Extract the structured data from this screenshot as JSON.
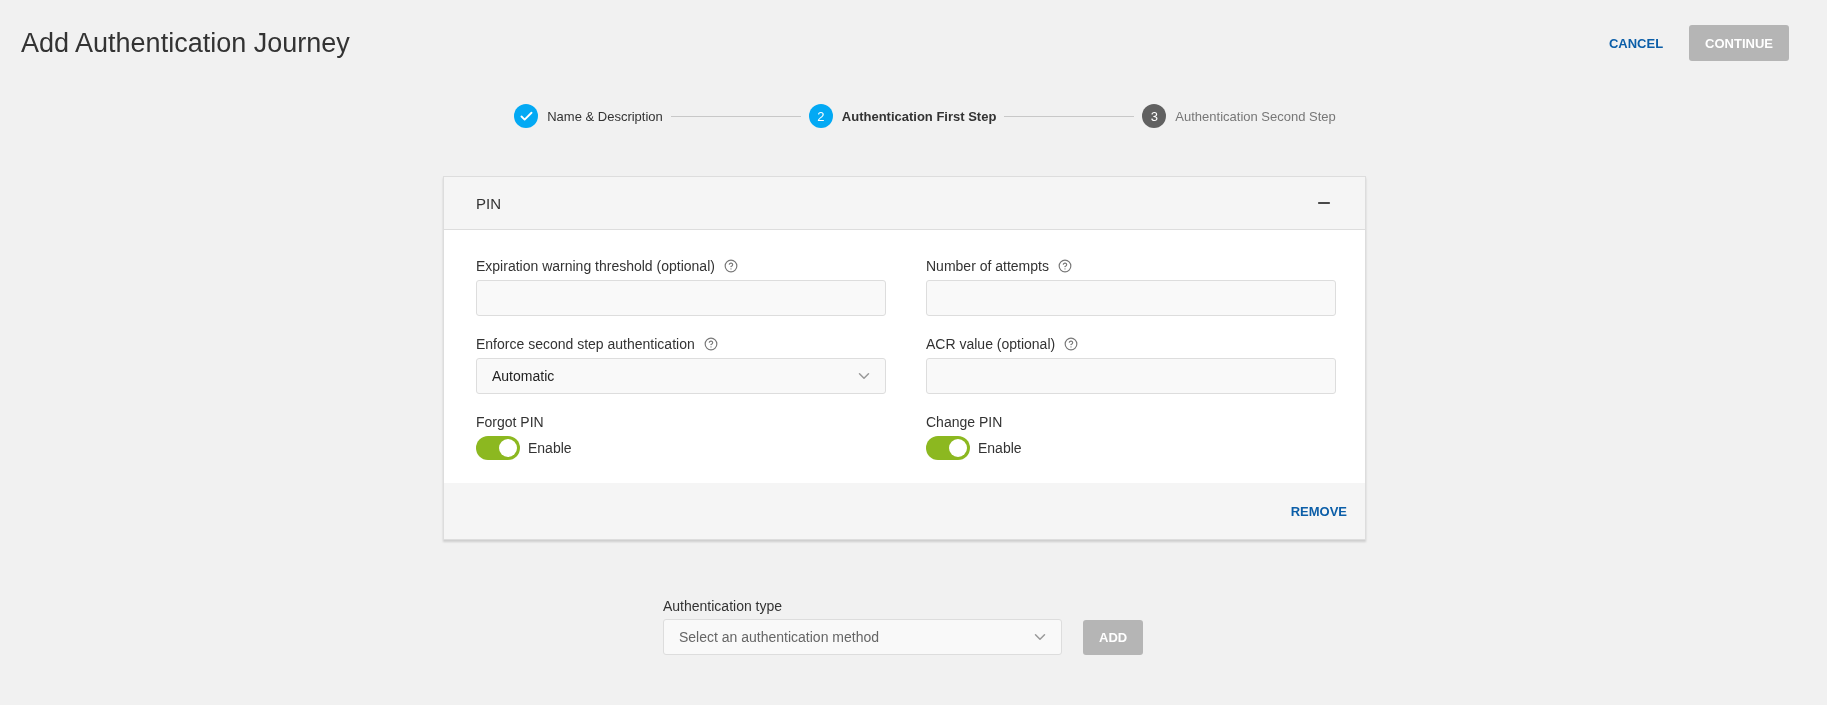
{
  "page": {
    "title": "Add Authentication Journey"
  },
  "actions": {
    "cancel": "CANCEL",
    "continue": {
      "label": "CONTINUE",
      "disabled": true
    }
  },
  "steps": [
    {
      "kind": "done",
      "label": "Name & Description"
    },
    {
      "kind": "active",
      "number": "2",
      "label": "Authentication First Step"
    },
    {
      "kind": "pending",
      "number": "3",
      "label": "Authentication Second Step"
    }
  ],
  "panel": {
    "title": "PIN",
    "expanded": true,
    "remove": "REMOVE",
    "fields": [
      {
        "kind": "text",
        "label": "Expiration warning threshold (optional)"
      },
      {
        "kind": "text",
        "label": "Number of attempts"
      },
      {
        "kind": "select",
        "label": "Enforce second step authentication",
        "value": "Automatic"
      },
      {
        "kind": "text",
        "label": "ACR value (optional)"
      },
      {
        "kind": "toggle",
        "label": "Forgot PIN",
        "on": true,
        "text": "Enable"
      },
      {
        "kind": "toggle",
        "label": "Change PIN",
        "on": true,
        "text": "Enable"
      }
    ]
  },
  "add_form": {
    "label": "Authentication type",
    "placeholder": "Select an authentication method",
    "button": {
      "label": "ADD",
      "disabled": true
    }
  }
}
